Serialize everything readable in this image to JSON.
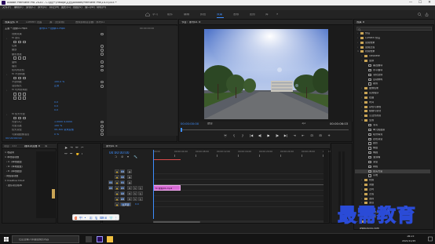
{
  "window": {
    "title": "Adobe Premiere Pro 2020 - C:\\用户\\Fdsojo\\文档\\Adobe\\Premiere Pro\\14.0\\333 *",
    "buttons": [
      "—",
      "☐",
      "✕"
    ]
  },
  "menubar": {
    "items": [
      "文件(F)",
      "编辑(E)",
      "剪辑(C)",
      "序列(S)",
      "标记(M)",
      "图形(G)",
      "视图(V)",
      "窗口(W)",
      "帮助(H)"
    ]
  },
  "workspaces": {
    "items": [
      "学习",
      "组件",
      "编辑",
      "颜色",
      "效果",
      "音频",
      "图形",
      "库"
    ],
    "active_index": 4
  },
  "effect_controls": {
    "tabs": [
      "效果控件 ≡",
      "Lumetri 范围",
      "源：(无剪辑)",
      "音频剪辑混合器：序列01"
    ],
    "clip_label": "主要 * 视频01.mp4",
    "clip_name": "序列01 * 视频01.mp4",
    "rows": [
      {
        "twirl": "",
        "label": "视频效果",
        "value": ""
      },
      {
        "twirl": "›",
        "label": "fx 运动",
        "value": ""
      },
      {
        "twirl": "",
        "label": "",
        "value": ""
      },
      {
        "twirl": "",
        "label": "位置",
        "value": ""
      },
      {
        "twirl": "",
        "label": "缩放",
        "value": ""
      },
      {
        "twirl": "",
        "label": "缩放宽度",
        "value": ""
      },
      {
        "twirl": "",
        "label": "",
        "value": ""
      },
      {
        "twirl": "",
        "label": "旋转",
        "value": ""
      },
      {
        "twirl": "",
        "label": "锚点",
        "value": ""
      },
      {
        "twirl": "",
        "label": "防闪烁滤镜",
        "value": ""
      },
      {
        "twirl": "›",
        "label": "fx 不透明度",
        "value": ""
      },
      {
        "twirl": "",
        "label": "",
        "value": ""
      },
      {
        "twirl": "",
        "label": "不透明度",
        "value": "100.0 %"
      },
      {
        "twirl": "",
        "label": "混合模式",
        "value": "正常"
      },
      {
        "twirl": "›",
        "label": "fx 时间重映射",
        "value": ""
      },
      {
        "twirl": "",
        "label": "",
        "value": ""
      },
      {
        "twirl": "",
        "label": "",
        "value": ""
      },
      {
        "twirl": "",
        "label": "",
        "value": "0.0"
      },
      {
        "twirl": "",
        "label": "",
        "value": "0.0"
      },
      {
        "twirl": "",
        "label": "",
        "value": "0.0"
      },
      {
        "twirl": "›",
        "label": "fx 镜头光晕",
        "value": ""
      },
      {
        "twirl": "",
        "label": "",
        "value": ""
      },
      {
        "twirl": "",
        "label": "光晕中心",
        "value": "1.0000  4.0000"
      },
      {
        "twirl": "",
        "label": "光晕亮度",
        "value": "100 %"
      },
      {
        "twirl": "",
        "label": "镜头类型",
        "value": "50-300 毫米变焦"
      },
      {
        "twirl": "",
        "label": "与原始图像混合",
        "value": "0 %"
      }
    ],
    "timecode": "00:00:00:00"
  },
  "program_monitor": {
    "tab": "节目：序列01 ≡",
    "timecode_left": "00:00:00:00",
    "fit": "适合",
    "ratio": "1/2",
    "timecode_right": "00:00:06:03",
    "controls": [
      "⦿",
      "{",
      "}",
      "|◀",
      "◀|",
      "▶",
      "|▶",
      "▶|",
      "⇥",
      "⇤",
      "⊡",
      "⊟",
      "+"
    ]
  },
  "project_panel": {
    "tab": "效果 ≡",
    "items": [
      {
        "level": 0,
        "type": "folder",
        "name": "预设"
      },
      {
        "level": 0,
        "type": "folder",
        "name": "Lumetri 预设"
      },
      {
        "level": 0,
        "type": "folder",
        "name": "音频效果"
      },
      {
        "level": 0,
        "type": "folder",
        "name": "音频过渡"
      },
      {
        "level": 0,
        "type": "folder",
        "name": "视频效果",
        "open": true
      },
      {
        "level": 1,
        "type": "folder",
        "name": "Obsolete"
      },
      {
        "level": 1,
        "type": "folder",
        "name": "变换"
      },
      {
        "level": 2,
        "type": "fx",
        "name": "垂直翻转"
      },
      {
        "level": 2,
        "type": "fx",
        "name": "水平翻转"
      },
      {
        "level": 2,
        "type": "fx",
        "name": "羽化边缘"
      },
      {
        "level": 2,
        "type": "fx",
        "name": "自动重构"
      },
      {
        "level": 2,
        "type": "fx",
        "name": "裁剪"
      },
      {
        "level": 1,
        "type": "folder",
        "name": "图像控制"
      },
      {
        "level": 1,
        "type": "folder",
        "name": "实用程序"
      },
      {
        "level": 1,
        "type": "folder",
        "name": "扭曲"
      },
      {
        "level": 1,
        "type": "folder",
        "name": "时间"
      },
      {
        "level": 1,
        "type": "folder",
        "name": "杂色与颗粒"
      },
      {
        "level": 1,
        "type": "folder",
        "name": "模糊与锐化"
      },
      {
        "level": 1,
        "type": "folder",
        "name": "沉浸式视频"
      },
      {
        "level": 1,
        "type": "folder",
        "name": "生成",
        "open": true
      },
      {
        "level": 2,
        "type": "fx",
        "name": "书写"
      },
      {
        "level": 2,
        "type": "fx",
        "name": "单元格图案"
      },
      {
        "level": 2,
        "type": "fx",
        "name": "吸管填充"
      },
      {
        "level": 2,
        "type": "fx",
        "name": "四色渐变"
      },
      {
        "level": 2,
        "type": "fx",
        "name": "圆形"
      },
      {
        "level": 2,
        "type": "fx",
        "name": "棋盘"
      },
      {
        "level": 2,
        "type": "fx",
        "name": "椭圆"
      },
      {
        "level": 2,
        "type": "fx",
        "name": "油漆桶"
      },
      {
        "level": 2,
        "type": "fx",
        "name": "渐变"
      },
      {
        "level": 2,
        "type": "fx",
        "name": "网格"
      },
      {
        "level": 2,
        "type": "fx",
        "name": "镜头光晕",
        "selected": true
      },
      {
        "level": 2,
        "type": "fx",
        "name": "闪电"
      },
      {
        "level": 1,
        "type": "folder",
        "name": "视频"
      },
      {
        "level": 1,
        "type": "folder",
        "name": "调整"
      },
      {
        "level": 1,
        "type": "folder",
        "name": "过时"
      },
      {
        "level": 1,
        "type": "folder",
        "name": "过渡"
      },
      {
        "level": 1,
        "type": "folder",
        "name": "透视"
      },
      {
        "level": 1,
        "type": "folder",
        "name": "通道"
      },
      {
        "level": 1,
        "type": "folder",
        "name": "键控"
      },
      {
        "level": 1,
        "type": "folder",
        "name": "颜色校正"
      },
      {
        "level": 1,
        "type": "folder",
        "name": "风格化"
      },
      {
        "level": 0,
        "type": "folder",
        "name": "视频过渡"
      }
    ]
  },
  "project_bin": {
    "tabs": [
      "项目：333",
      "媒体浏览器 ≡",
      "库",
      "信息"
    ],
    "tree": [
      "∨ 收藏夹",
      "∨ 本地驱动器",
      "  › C: (本地磁盘)",
      "  › D: (本地磁盘)",
      "  › E: (本地磁盘)",
      "› 网络驱动器",
      "∨ Creative Cloud",
      "  › 团队项目版本"
    ]
  },
  "timeline": {
    "tab": "序列01 ≡",
    "timecode": "00:00:00:00",
    "ruler": [
      ":00:00",
      "00:00:04:00",
      "00:00:08:00",
      "00:00:12:00",
      "00:00:16:00",
      "00:00:20:00",
      "00:00:24:00",
      "00:00:28:00",
      "00:00:32:00"
    ],
    "tracks": [
      {
        "label": "V3",
        "patch": ""
      },
      {
        "label": "V2",
        "patch": ""
      },
      {
        "label": "V1",
        "patch": "V1"
      },
      {
        "label": "A1",
        "patch": "A1"
      },
      {
        "label": "A2",
        "patch": ""
      },
      {
        "label": "A3",
        "patch": ""
      },
      {
        "label": "主声道",
        "patch": ""
      }
    ],
    "master_value": "0.0",
    "clip_label": "fx 视频01.mp4"
  },
  "ime_bar": {
    "items": [
      "S",
      "中",
      "•",
      "㊣",
      "🎙",
      "⌨",
      "⊞",
      "👕",
      "⋮"
    ]
  },
  "taskbar": {
    "search_placeholder": "在这里输入你要搜索的内容",
    "time": "16:25",
    "date": "2021/11/25"
  },
  "watermark": {
    "text": "最需教育",
    "url": "www.zuixu.com"
  },
  "colors": {
    "accent": "#3d8eff",
    "clip": "#d76bd4"
  }
}
